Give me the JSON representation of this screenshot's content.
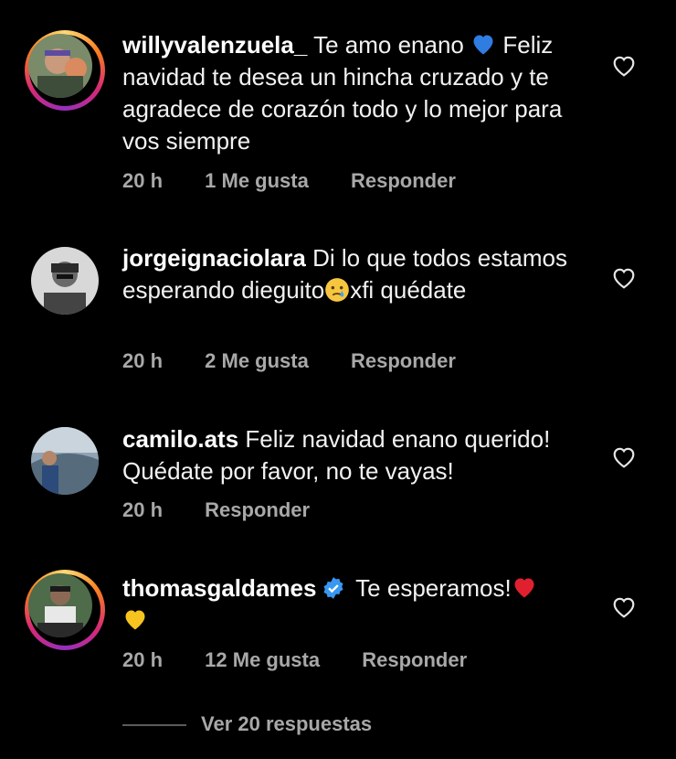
{
  "comments": [
    {
      "username": "willyvalenzuela_",
      "text_before": "Te amo enano",
      "emoji": "blue-heart",
      "text_after": "Feliz navidad  te desea un hincha cruzado y te agradece de corazón todo y lo mejor para vos siempre",
      "time": "20 h",
      "likes": "1 Me gusta",
      "reply": "Responder"
    },
    {
      "username": "jorgeignaciolara",
      "text_before": "Di lo que todos estamos esperando dieguito",
      "emoji": "crying-face",
      "text_after": "xfi quédate",
      "time": "20 h",
      "likes": "2 Me gusta",
      "reply": "Responder"
    },
    {
      "username": "camilo.ats",
      "text_before": "Feliz navidad enano querido! Quédate por favor, no te vayas!",
      "time": "20 h",
      "reply": "Responder"
    },
    {
      "username": "thomasgaldames",
      "verified": true,
      "text_before": "Te esperamos!",
      "emoji": "red-heart",
      "emoji2": "yellow-heart",
      "time": "20 h",
      "likes": "12 Me gusta",
      "reply": "Responder"
    }
  ],
  "view_replies": "Ver 20 respuestas",
  "colors": {
    "background": "#000000",
    "text": "#f2f2f2",
    "secondary": "#a8a8a8",
    "verified": "#3897f0"
  }
}
